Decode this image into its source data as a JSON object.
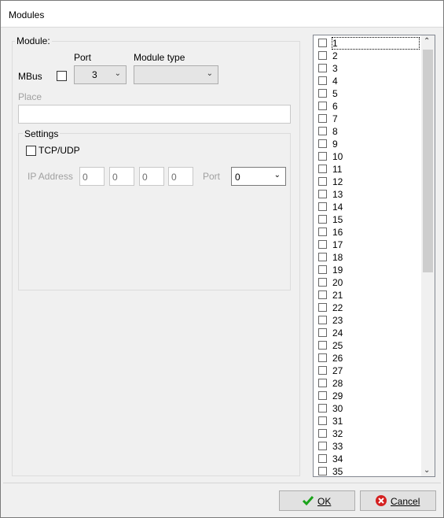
{
  "window": {
    "title": "Modules"
  },
  "module_group": {
    "legend": "Module:",
    "mbus_label": "MBus",
    "mbus_checked": false,
    "port_label": "Port",
    "port_value": "3",
    "module_type_label": "Module type",
    "module_type_value": "",
    "place_label": "Place",
    "place_value": ""
  },
  "settings_group": {
    "legend": "Settings",
    "tcp_label": "TCP/UDP",
    "tcp_checked": false,
    "ip_label": "IP Address",
    "ip": [
      "0",
      "0",
      "0",
      "0"
    ],
    "port_label": "Port",
    "port_value": "0"
  },
  "list": {
    "items": [
      "1",
      "2",
      "3",
      "4",
      "5",
      "6",
      "7",
      "8",
      "9",
      "10",
      "11",
      "12",
      "13",
      "14",
      "15",
      "16",
      "17",
      "18",
      "19",
      "20",
      "21",
      "22",
      "23",
      "24",
      "25",
      "26",
      "27",
      "28",
      "29",
      "30",
      "31",
      "32",
      "33",
      "34",
      "35"
    ]
  },
  "buttons": {
    "ok": "OK",
    "cancel": "Cancel"
  },
  "icons": {
    "ok": "check-icon",
    "cancel": "cancel-icon"
  },
  "colors": {
    "ok_check": "#1aa31a",
    "cancel_red": "#d42020"
  }
}
